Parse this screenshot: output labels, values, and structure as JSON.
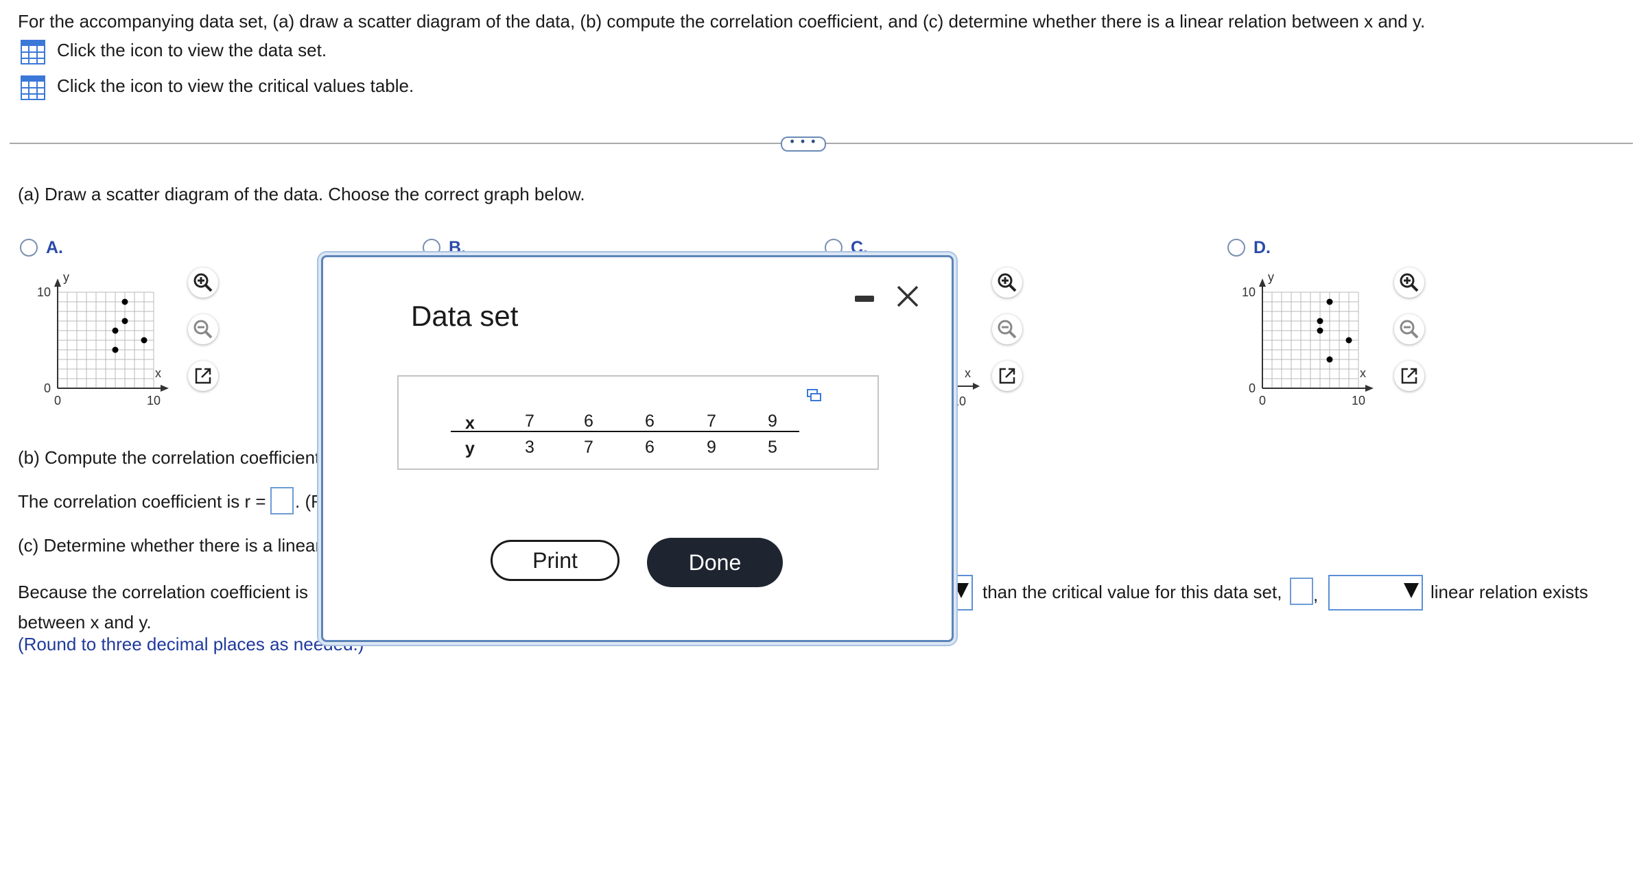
{
  "question": {
    "prompt": "For the accompanying data set, (a) draw a scatter diagram of the data, (b) compute the correlation coefficient, and (c) determine whether there is a linear relation between x and y.",
    "data_link": "Click the icon to view the data set.",
    "critical_link": "Click the icon to view the critical values table."
  },
  "more_button": "• • •",
  "part_a": {
    "instruction": "(a) Draw a scatter diagram of the data. Choose the correct graph below.",
    "options": [
      {
        "letter": "A.",
        "points": [
          [
            6,
            6
          ],
          [
            6,
            4
          ],
          [
            7,
            7
          ],
          [
            7,
            9
          ],
          [
            9,
            5
          ]
        ]
      },
      {
        "letter": "B."
      },
      {
        "letter": "C."
      },
      {
        "letter": "D.",
        "points": [
          [
            6,
            7
          ],
          [
            6,
            6
          ],
          [
            7,
            3
          ],
          [
            7,
            9
          ],
          [
            9,
            5
          ]
        ]
      }
    ],
    "axis": {
      "y_label": "y",
      "x_label": "x",
      "zero": "0",
      "ten": "10"
    }
  },
  "part_b": {
    "instruction": "(b) Compute the correlation coefficient",
    "answer_prefix": "The correlation coefficient is r =",
    "answer_suffix": ". (R"
  },
  "part_c": {
    "instruction": "(c) Determine whether there is a linear",
    "sentence_start": "Because the correlation coefficient is",
    "sentence_mid": "than the critical value for this data set,",
    "comma": ",",
    "sentence_end": "linear relation exists",
    "line2": "between x and y.",
    "round_note": "(Round to three decimal places as needed.)"
  },
  "modal": {
    "title": "Data set",
    "x_header": "x",
    "y_header": "y",
    "x_values": [
      "7",
      "6",
      "6",
      "7",
      "9"
    ],
    "y_values": [
      "3",
      "7",
      "6",
      "9",
      "5"
    ],
    "print_label": "Print",
    "done_label": "Done"
  }
}
